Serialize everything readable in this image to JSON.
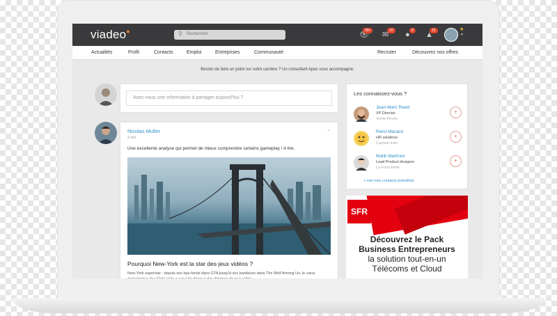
{
  "app": {
    "logo": "viadeo"
  },
  "search": {
    "placeholder": "Rechercher"
  },
  "notifications": [
    {
      "icon": "eye-icon",
      "count": "99+"
    },
    {
      "icon": "mail-icon",
      "count": "10"
    },
    {
      "icon": "user-icon",
      "count": "8"
    },
    {
      "icon": "bell-icon",
      "count": "15"
    }
  ],
  "menu": {
    "items": [
      "Actualités",
      "Profil",
      "Contacts",
      "Emploi",
      "Entreprises",
      "Communauté"
    ],
    "right": [
      "Recruter",
      "Découvrez nos offres"
    ]
  },
  "banner": {
    "text": "Besoin de faire un point sur votre carrière ? Un consultant Apec vous accompagne."
  },
  "composer": {
    "placeholder": "Avez-vous une information à partager aujourd'hui ?"
  },
  "post": {
    "author": "Nicolas Muller",
    "time": "3 min",
    "text": "Une excellente analyse qui permet de mieux comprendre certains gameplay ! A lire.",
    "article_title": "Pourquoi New-York est la star des jeux vidéos ?",
    "article_desc": "New-York superstar : depuis ses bas-fonds dans GTA jusqu'à ses banlieues dans The Wolf Among Us, le cœur économique des États-Unis a servi de décor à des dizaines de jeux vidéo."
  },
  "suggestions": {
    "title": "Les connaissez-vous ?",
    "people": [
      {
        "name": "Jean-Marc Reed",
        "role": "VP Director",
        "company": "Vente Privée"
      },
      {
        "name": "Rémi Menard",
        "role": "HR solutions",
        "company": "Captain train"
      },
      {
        "name": "Malik Martinez",
        "role": "Lead Product designer",
        "company": "La Fourchette"
      }
    ],
    "see_all": "> voir mes contacts potentiels"
  },
  "ad": {
    "brand": "SFR",
    "line1": "Découvrez le Pack",
    "line2": "Business Entrepreneurs",
    "line3": "la solution tout-en-un",
    "line4": "Télécoms et Cloud"
  },
  "colors": {
    "topbar": "#3a3a3c",
    "link": "#2f90c9",
    "badge": "#e0452c",
    "brand_accent": "#f07e26",
    "sfr_red": "#e3000f"
  }
}
